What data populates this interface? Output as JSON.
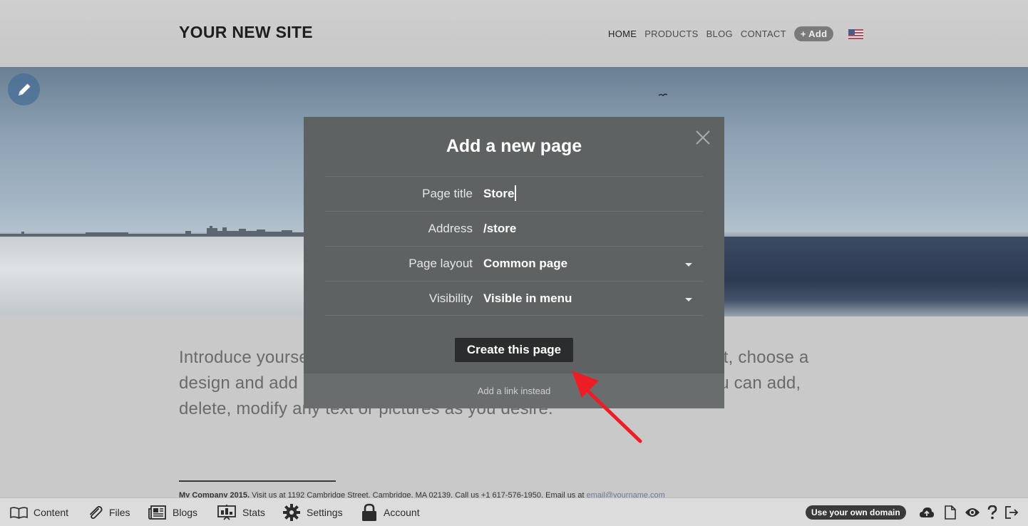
{
  "site": {
    "title": "YOUR NEW SITE",
    "nav": [
      "HOME",
      "PRODUCTS",
      "BLOG",
      "CONTACT"
    ],
    "add_label": "+ Add"
  },
  "content": {
    "intro": "Introduce yourself and your business here. Learn about how to edit text, choose a design and add photos. The look of your site is fully customizable – you can add, delete, modify any text or pictures as you desire.",
    "footer_company": "My Company 2015.",
    "footer_text": " Visit us at 1192 Cambridge Street, Cambridge, MA 02139. Call us +1 617-576-1950. Email us at ",
    "footer_email": "email@yourname.com"
  },
  "modal": {
    "title": "Add a new page",
    "fields": [
      {
        "label": "Page title",
        "value": "Store"
      },
      {
        "label": "Address",
        "value": "/store"
      },
      {
        "label": "Page layout",
        "value": "Common page"
      },
      {
        "label": "Visibility",
        "value": "Visible in menu"
      }
    ],
    "create_label": "Create this page",
    "link_instead": "Add a link instead"
  },
  "toolbar": {
    "content": "Content",
    "files": "Files",
    "blogs": "Blogs",
    "stats": "Stats",
    "settings": "Settings",
    "account": "Account",
    "domain": "Use your own domain"
  },
  "colors": {
    "annotation_arrow": "#ee1c24",
    "modal_bg": "#5f6263"
  }
}
